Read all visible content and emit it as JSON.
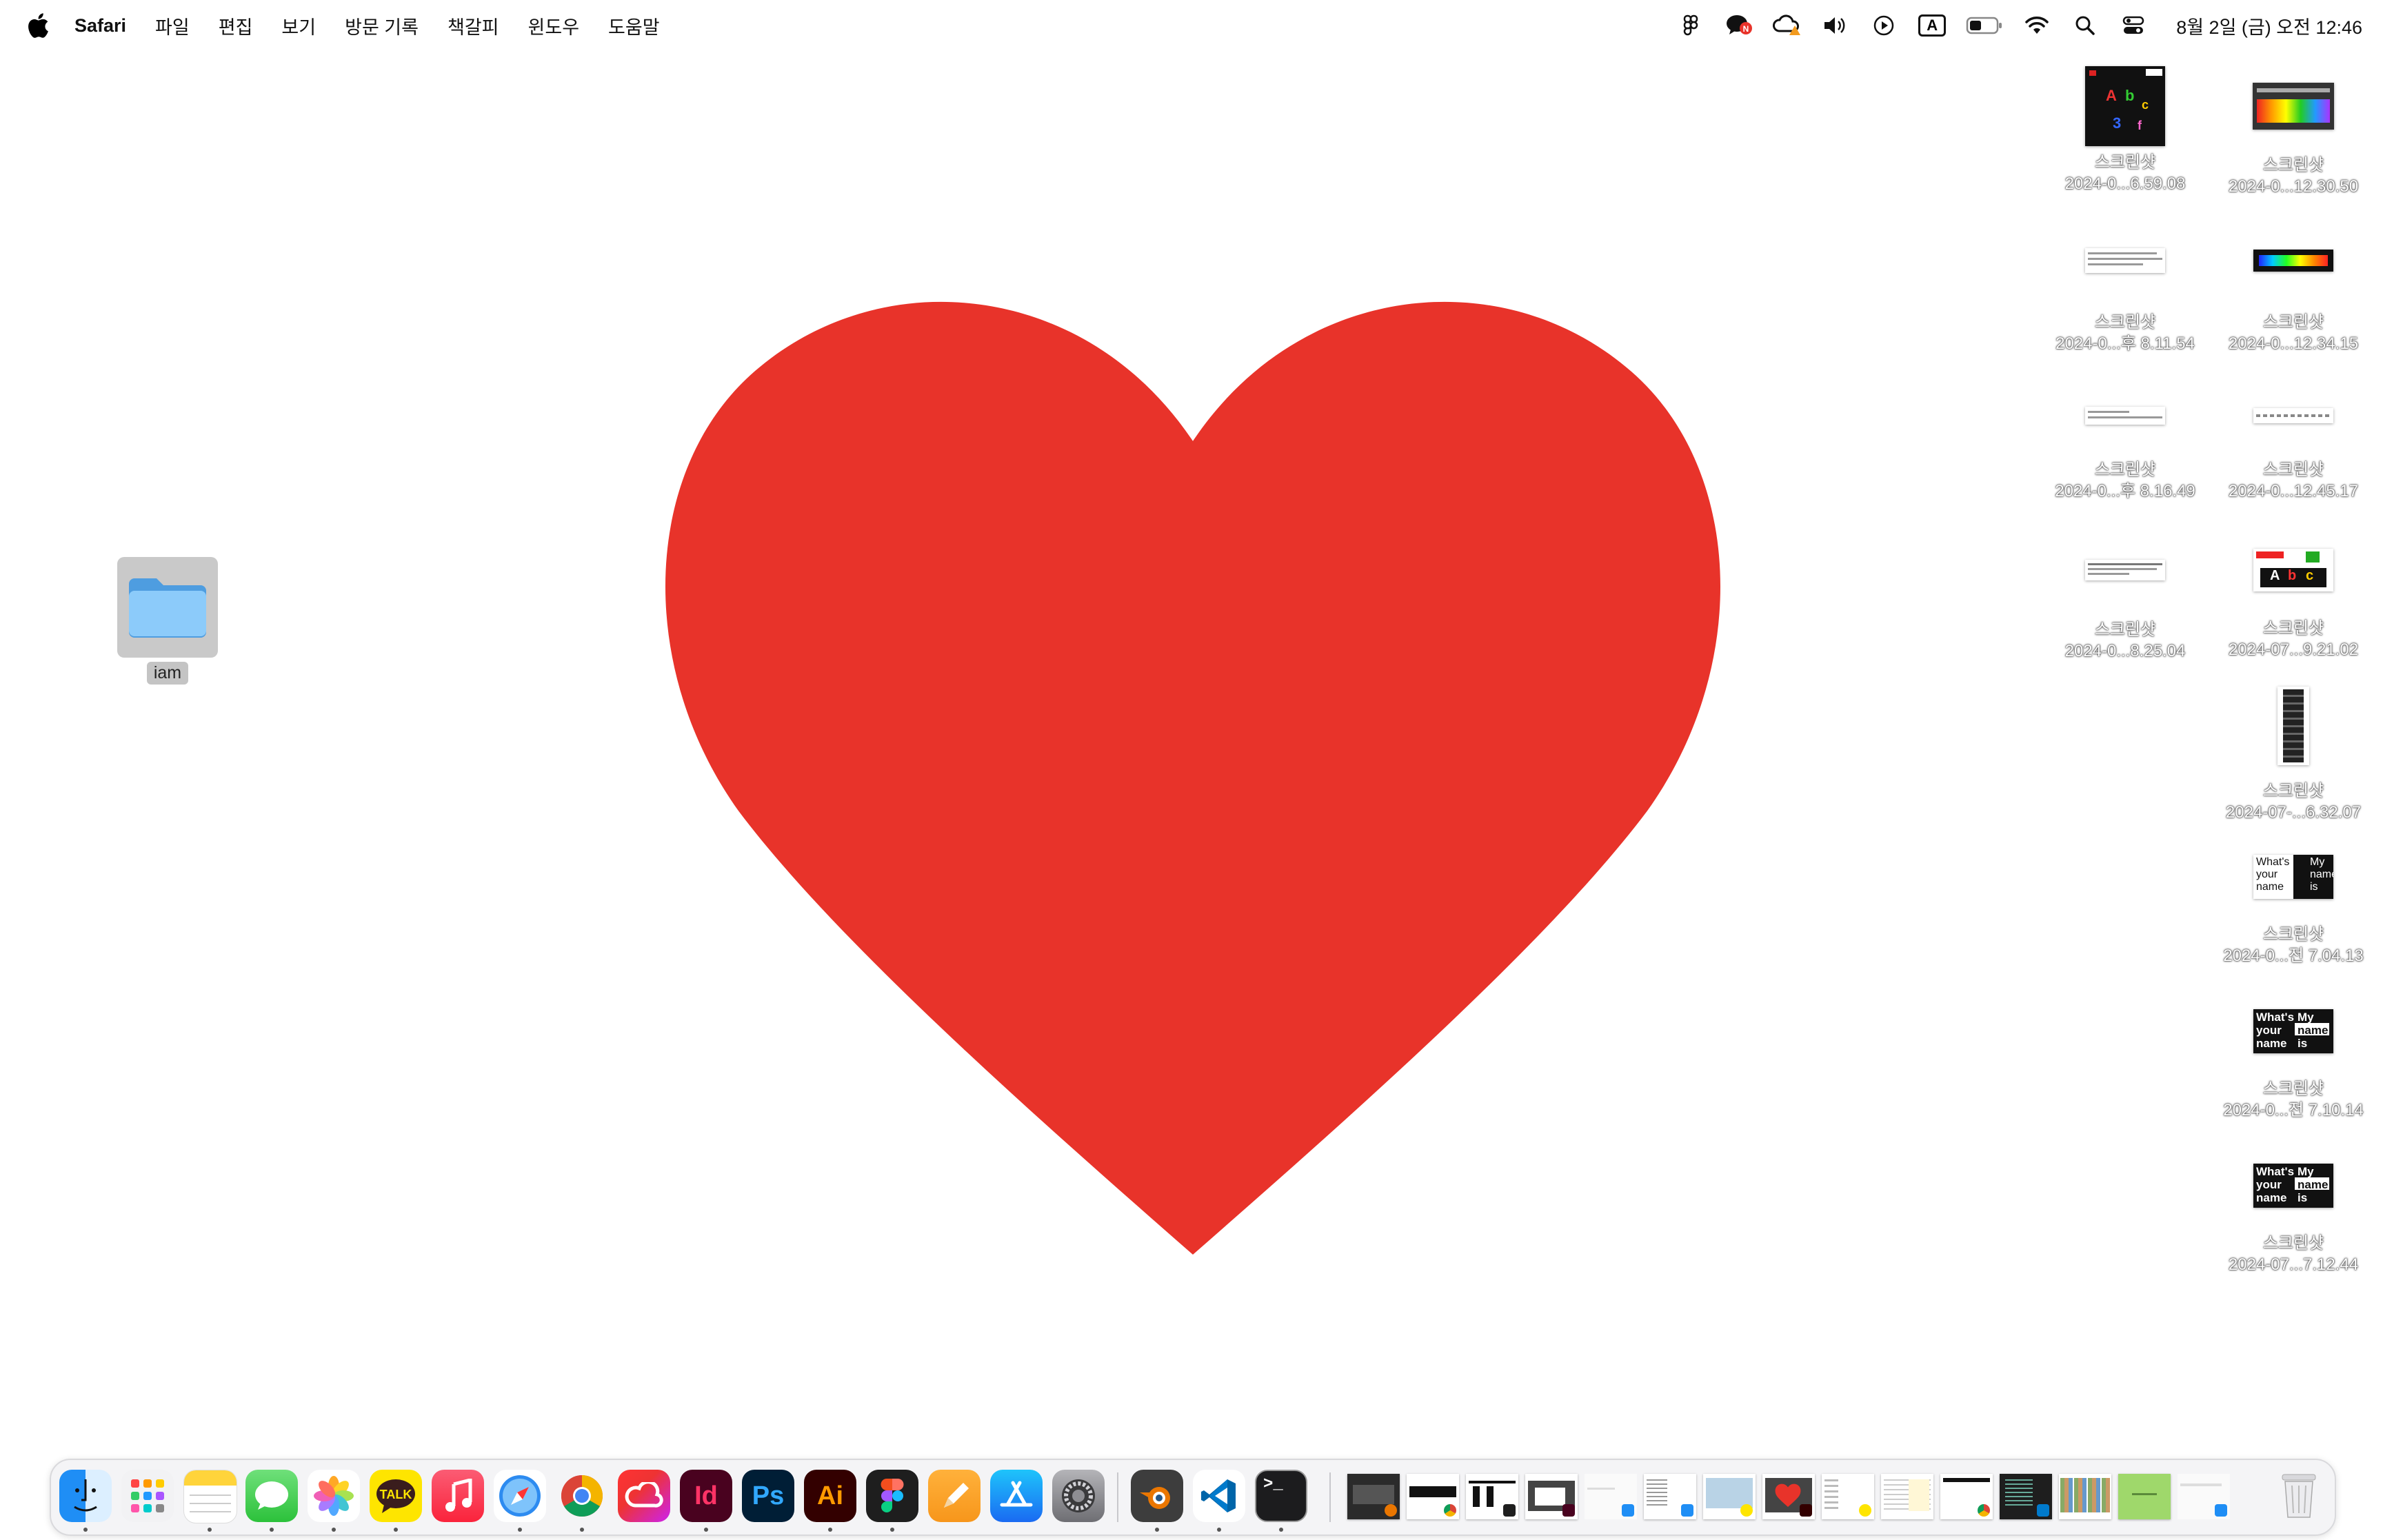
{
  "menubar": {
    "apple_icon": "apple-logo-icon",
    "app_name": "Safari",
    "items": [
      "파일",
      "편집",
      "보기",
      "방문 기록",
      "책갈피",
      "윈도우",
      "도움말"
    ],
    "status_icons": [
      "figma-icon",
      "kakaotalk-badge-icon",
      "creative-cloud-warning-icon",
      "volume-icon",
      "play-icon",
      "input-source-icon",
      "battery-icon",
      "wifi-icon",
      "search-icon",
      "control-center-icon"
    ],
    "input_source": "A",
    "kakaotalk_badge": "N",
    "clock": "8월 2일 (금) 오전 12:46"
  },
  "desktop": {
    "heart_color": "#E8332A",
    "folder": {
      "label": "iam",
      "color": "#67B7F3"
    },
    "files": [
      {
        "line1": "스크린샷",
        "line2": "2024-0...6.59.08",
        "thumb": "poster"
      },
      {
        "line1": "스크린샷",
        "line2": "2024-0...12.30.50",
        "thumb": "dark-banner"
      },
      {
        "line1": "스크린샷",
        "line2": "2024-0...후 8.11.54",
        "thumb": "text-strip"
      },
      {
        "line1": "스크린샷",
        "line2": "2024-0...12.34.15",
        "thumb": "gradient-strip"
      },
      {
        "line1": "스크린샷",
        "line2": "2024-0...후 8.16.49",
        "thumb": "text-strip-small"
      },
      {
        "line1": "스크린샷",
        "line2": "2024-0...12.45.17",
        "thumb": "dotted-strip"
      },
      {
        "line1": "스크린샷",
        "line2": "2024-0...8.25.04",
        "thumb": "text-strip"
      },
      {
        "line1": "스크린샷",
        "line2": "2024-07...9.21.02",
        "thumb": "mini-poster"
      },
      {
        "line1": "스크린샷",
        "line2": "2024-07-...6.32.07",
        "thumb": "tall-strip"
      },
      {
        "line1": "스크린샷",
        "line2": "2024-0...전 7.04.13",
        "thumb": "name-card",
        "words": [
          "What's",
          "your",
          "name",
          "My",
          "name",
          "is"
        ]
      },
      {
        "line1": "스크린샷",
        "line2": "2024-0...전 7.10.14",
        "thumb": "name-card-inverse",
        "words": [
          "What's",
          "your",
          "name",
          "My",
          "name",
          "is"
        ]
      },
      {
        "line1": "스크린샷",
        "line2": "2024-07...7.12.44",
        "thumb": "name-card-inverse",
        "words": [
          "What's",
          "your",
          "name",
          "My",
          "name",
          "is"
        ]
      }
    ]
  },
  "dock": {
    "apps": [
      {
        "name": "finder-icon",
        "running": true
      },
      {
        "name": "launchpad-icon",
        "running": false
      },
      {
        "name": "notes-icon",
        "running": true
      },
      {
        "name": "messages-icon",
        "running": true
      },
      {
        "name": "photos-icon",
        "running": true
      },
      {
        "name": "kakaotalk-icon",
        "label": "TALK",
        "running": true
      },
      {
        "name": "music-icon",
        "running": false
      },
      {
        "name": "safari-icon",
        "running": true
      },
      {
        "name": "chrome-icon",
        "running": true
      },
      {
        "name": "creative-cloud-icon",
        "running": false
      },
      {
        "name": "indesign-icon",
        "label": "Id",
        "running": true
      },
      {
        "name": "photoshop-icon",
        "label": "Ps",
        "running": false
      },
      {
        "name": "illustrator-icon",
        "label": "Ai",
        "running": true
      },
      {
        "name": "figma-icon",
        "running": true
      },
      {
        "name": "pages-icon",
        "running": false
      },
      {
        "name": "app-store-icon",
        "running": false
      },
      {
        "name": "system-settings-icon",
        "running": false
      },
      {
        "name": "blender-icon",
        "running": true
      },
      {
        "name": "vscode-icon",
        "running": true
      },
      {
        "name": "terminal-icon",
        "label": ">_",
        "running": true
      }
    ],
    "windows": [
      "blender-window-thumb",
      "chrome-window-thumb",
      "figma-window-thumb",
      "indesign-window-thumb",
      "finder-window-thumb",
      "finder-window-thumb-2",
      "kakaotalk-window-thumb",
      "illustrator-window-thumb",
      "kakaotalk-window-thumb-2",
      "notes-window-thumb",
      "chrome-window-thumb-2",
      "vscode-window-thumb",
      "photos-window-thumb",
      "stickies-window-thumb",
      "finder-window-thumb-3"
    ],
    "trash": "trash-icon"
  }
}
